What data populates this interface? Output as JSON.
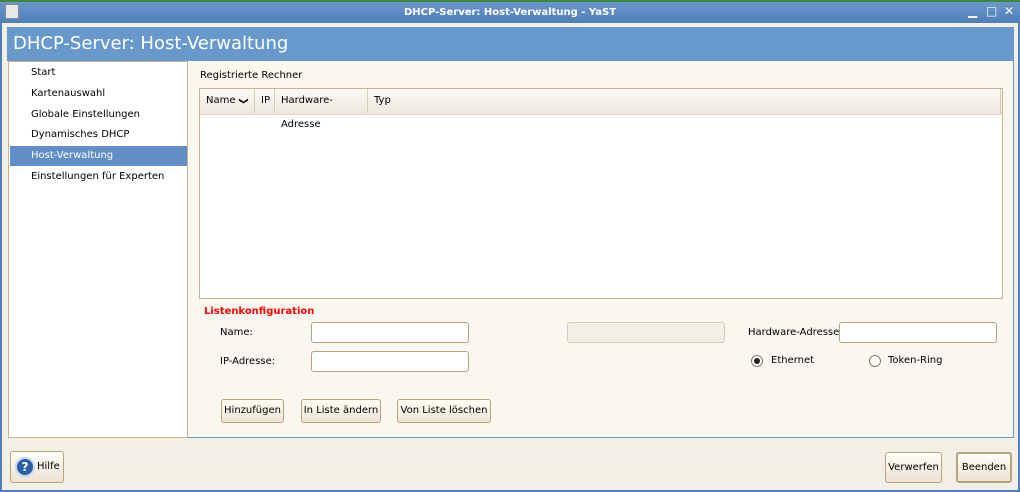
{
  "window": {
    "title": "DHCP-Server: Host-Verwaltung - YaST"
  },
  "header": {
    "title": "DHCP-Server: Host-Verwaltung"
  },
  "sidebar": {
    "items": [
      {
        "label": "Start"
      },
      {
        "label": "Kartenauswahl"
      },
      {
        "label": "Globale Einstellungen"
      },
      {
        "label": "Dynamisches DHCP"
      },
      {
        "label": "Host-Verwaltung",
        "selected": true
      },
      {
        "label": "Einstellungen für Experten"
      }
    ]
  },
  "table": {
    "title": "Registrierte Rechner",
    "columns": [
      "Name",
      "IP",
      "Hardware-Adresse",
      "Typ"
    ],
    "rows": []
  },
  "form": {
    "section_title": "Listenkonfiguration",
    "name_label": "Name:",
    "name_value": "",
    "ip_label": "IP-Adresse:",
    "ip_value": "",
    "hw_label": "Hardware-Adresse:",
    "hw_value": "",
    "disabled_value": "",
    "radio_ethernet": "Ethernet",
    "radio_token": "Token-Ring",
    "selected_type": "Ethernet",
    "add_button": "Hinzufügen",
    "change_button": "In Liste ändern",
    "delete_button": "Von Liste löschen"
  },
  "footer": {
    "help": "Hilfe",
    "discard": "Verwerfen",
    "finish": "Beenden"
  },
  "colors": {
    "accent": "#6799cc",
    "section_title": "#ff0000"
  }
}
